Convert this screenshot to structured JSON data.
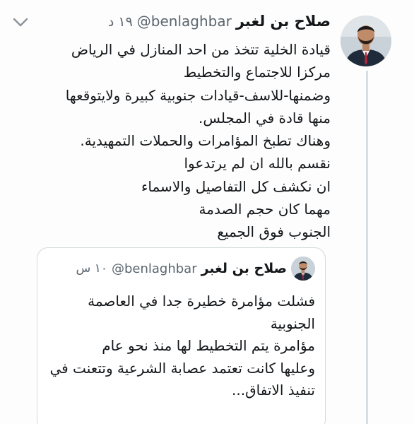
{
  "tweet": {
    "display_name": "صلاح بن لغبر",
    "handle": "@benlaghbar",
    "timestamp": "١٩ د",
    "lines": [
      "قيادة الخلية تتخذ من احد المنازل في الرياض",
      "مركزا للاجتماع والتخطيط",
      "وضمنها-للاسف-قيادات جنوبية كبيرة ولايتوقعها",
      "منها قادة في المجلس.",
      "وهناك تطبخ المؤامرات والحملات التمهيدية.",
      "نقسم بالله ان لم يرتدعوا",
      "ان نكشف كل التفاصيل والاسماء",
      "مهما كان حجم الصدمة",
      "الجنوب فوق الجميع"
    ]
  },
  "quoted_tweet": {
    "display_name": "صلاح بن لغبر",
    "handle": "@benlaghbar",
    "timestamp": "١٠ س",
    "lines": [
      "فشلت مؤامرة خطيرة جدا في العاصمة",
      "الجنوبية",
      "مؤامرة يتم التخطيط لها منذ نحو عام",
      "وعليها كانت تعتمد عصابة الشرعية وتتعنت في",
      "تنفيذ الاتفاق..."
    ]
  },
  "icons": {
    "menu": "chevron-down-icon",
    "avatar": "profile-photo",
    "quote_avatar": "profile-photo"
  },
  "colors": {
    "text": "#14171a",
    "secondary": "#5b6670",
    "border": "#d3d9de"
  }
}
